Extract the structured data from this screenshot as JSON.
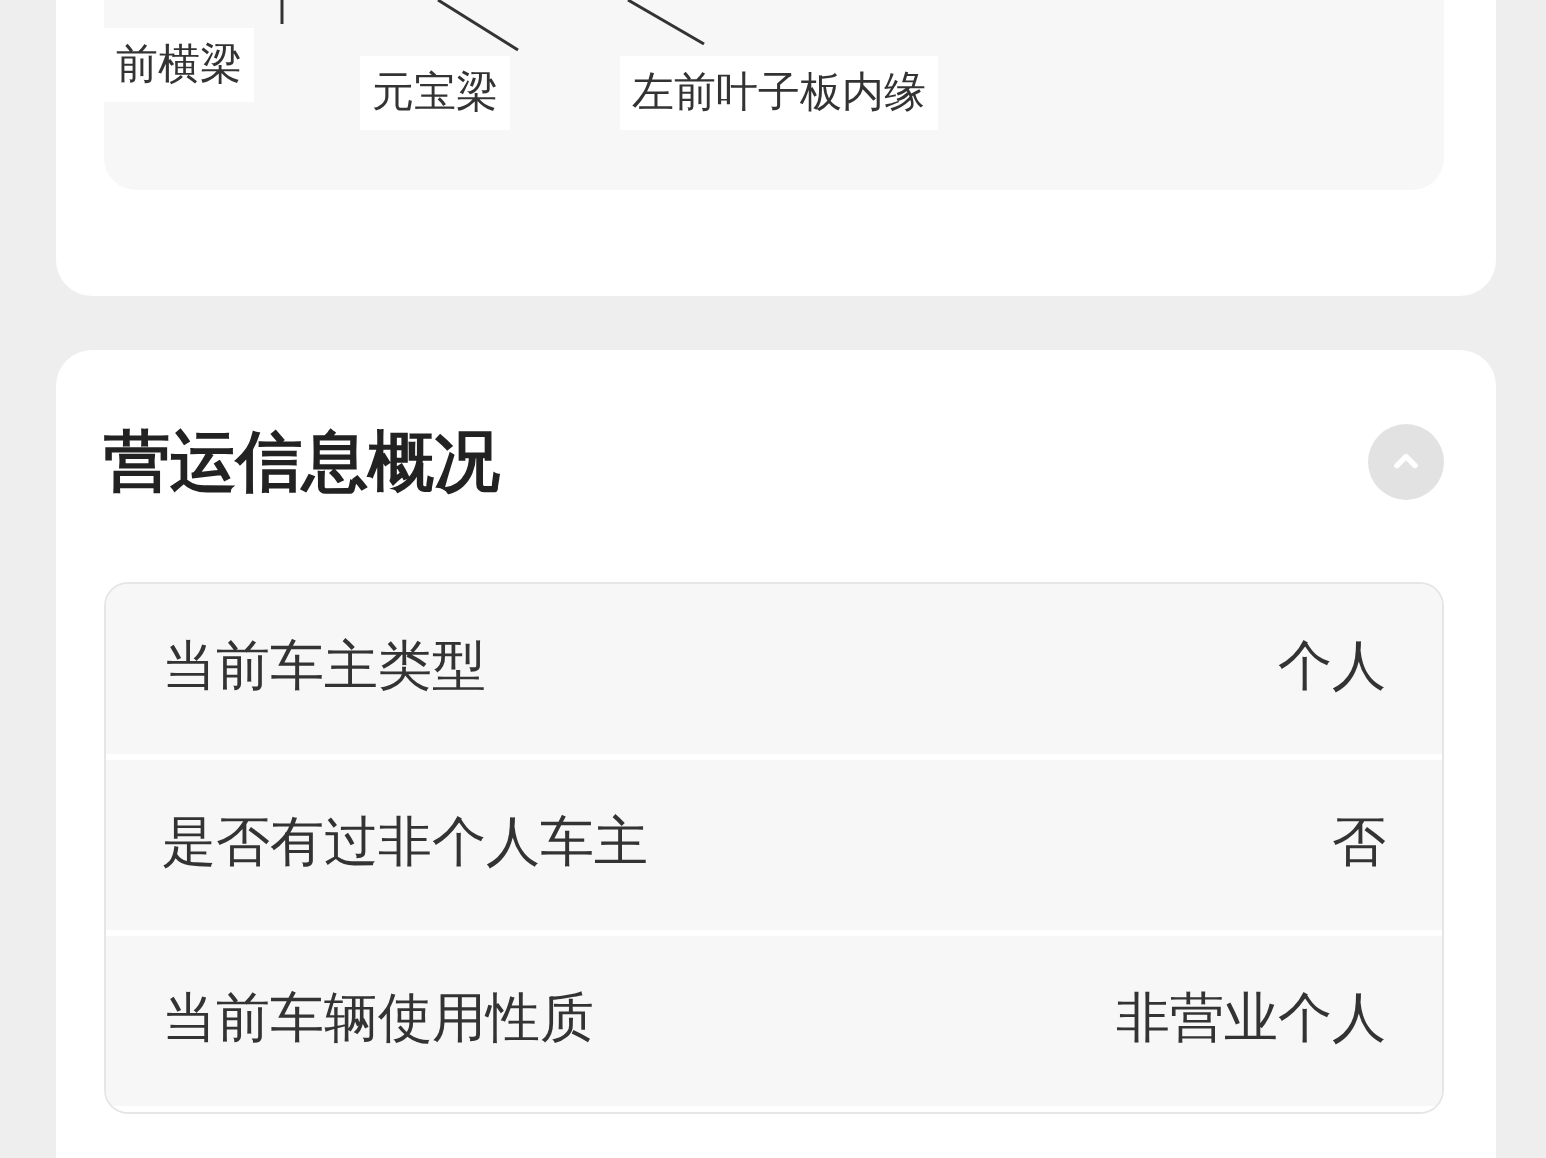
{
  "diagram": {
    "labels": [
      "前横梁",
      "元宝梁",
      "左前叶子板内缘"
    ]
  },
  "section": {
    "title": "营运信息概况",
    "expanded": true,
    "rows": [
      {
        "label": "当前车主类型",
        "value": "个人"
      },
      {
        "label": "是否有过非个人车主",
        "value": "否"
      },
      {
        "label": "当前车辆使用性质",
        "value": "非营业个人"
      }
    ]
  }
}
